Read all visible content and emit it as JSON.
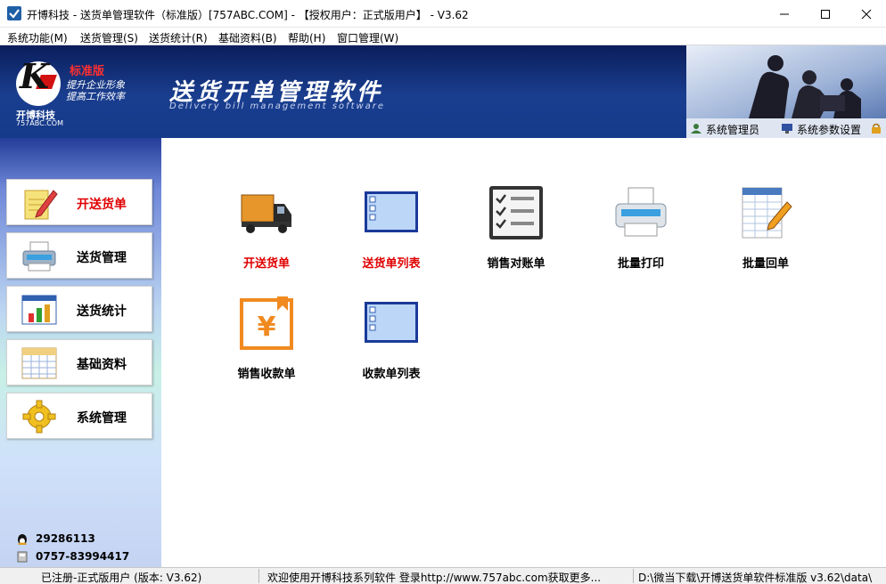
{
  "window": {
    "title": "开博科技 - 送货单管理软件（标准版）[757ABC.COM] - 【授权用户：正式版用户】 - V3.62"
  },
  "menu": [
    "系统功能(M)",
    "送货管理(S)",
    "送货统计(R)",
    "基础资料(B)",
    "帮助(H)",
    "窗口管理(W)"
  ],
  "banner": {
    "edition": "标准版",
    "slogan1": "提升企业形象",
    "slogan2": "提高工作效率",
    "company": "开博科技",
    "domain": "757ABC.COM",
    "title": "送货开单管理软件",
    "subtitle": "Delivery bill management software",
    "user_label": "系统管理员",
    "settings_label": "系统参数设置"
  },
  "sidebar": {
    "items": [
      {
        "label": "开送货单",
        "icon": "notepad-pencil-icon",
        "active": true
      },
      {
        "label": "送货管理",
        "icon": "printer-icon",
        "active": false
      },
      {
        "label": "送货统计",
        "icon": "bar-chart-icon",
        "active": false
      },
      {
        "label": "基础资料",
        "icon": "calendar-grid-icon",
        "active": false
      },
      {
        "label": "系统管理",
        "icon": "gear-icon",
        "active": false
      }
    ],
    "qq": "29286113",
    "phone": "0757-83994417"
  },
  "tiles": [
    {
      "label": "开送货单",
      "icon": "truck-icon",
      "highlight": true
    },
    {
      "label": "送货单列表",
      "icon": "list-window-icon",
      "highlight": true
    },
    {
      "label": "销售对账单",
      "icon": "checklist-icon",
      "highlight": false
    },
    {
      "label": "批量打印",
      "icon": "printer-icon",
      "highlight": false
    },
    {
      "label": "批量回单",
      "icon": "spreadsheet-pencil-icon",
      "highlight": false
    },
    {
      "label": "销售收款单",
      "icon": "yuan-receipt-icon",
      "highlight": false
    },
    {
      "label": "收款单列表",
      "icon": "list-window-icon",
      "highlight": false
    }
  ],
  "status": {
    "registration": "已注册-正式版用户 (版本: V3.62)",
    "message": "欢迎使用开博科技系列软件   登录http://www.757abc.com获取更多...",
    "path": "D:\\微当下载\\开博送货单软件标准版 v3.62\\data\\"
  },
  "colors": {
    "banner": "#1a3e8f",
    "active_red": "#e00000"
  }
}
